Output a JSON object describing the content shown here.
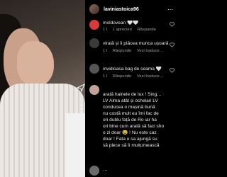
{
  "header": {
    "username": "laviniastoica96",
    "more_glyph": "⋯"
  },
  "photo": {
    "more_glyph": "⋮"
  },
  "comments": [
    {
      "id": "c1",
      "text": "moldovean 🤍🤍",
      "time": "1 l",
      "likes": "1 aprecieri",
      "reply": "Răspunde",
      "avatar_color": "#d93b3b"
    },
    {
      "id": "c2",
      "text": "virală și îi plăcea munca ușoară",
      "time": "1 l",
      "reply": "Răspunde",
      "view": "Vezi traduce…",
      "avatar_color": "#3a3a3a"
    },
    {
      "id": "c3",
      "text": "invidioasa bag de seama 🤍",
      "time": "1 l",
      "reply": "Răspunde",
      "view": "Vezi traduce…",
      "avatar_color": "#555555"
    },
    {
      "id": "c4",
      "lines": [
        "arată hainele de lux ! Sing…",
        "LV Alma atât și ochelari LV",
        "conducea o mașină bună",
        "nu costă mult eu îmi fac de",
        "ori dublu față de Ro iar ha",
        "ori bine cum arată să faci sho",
        "o zi doar 😂 ! Nu este caz",
        "doar ! Fata o sa ajungă su",
        "să plece să îi mulțumească"
      ],
      "avatar_color": "#c2a39a"
    },
    {
      "id": "c5",
      "text": "…",
      "avatar_color": "#6b6b6b"
    }
  ]
}
